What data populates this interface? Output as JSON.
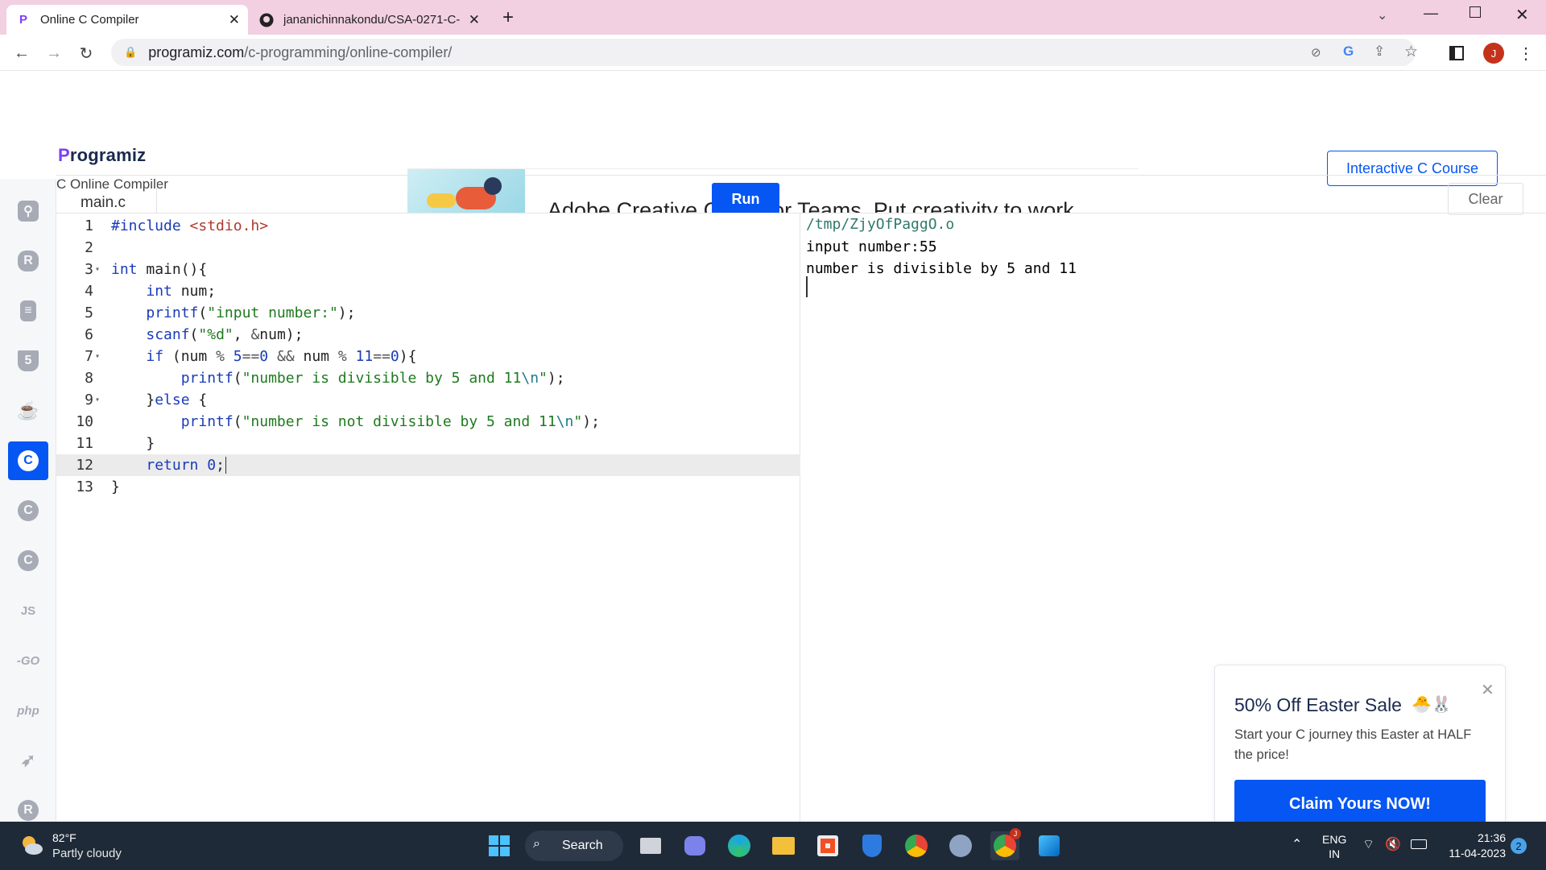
{
  "browser": {
    "tabs": [
      {
        "title": "Online C Compiler",
        "active": true
      },
      {
        "title": "jananichinnakondu/CSA-0271-C-",
        "active": false
      }
    ],
    "new_tab": "+",
    "url_host": "programiz.com",
    "url_path": "/c-programming/online-compiler/",
    "profile_initial": "J"
  },
  "header": {
    "logo_p": "P",
    "logo_rest": "rogramiz",
    "course_button": "Interactive C Course",
    "compiler_title": "C Online Compiler"
  },
  "ad": {
    "text": "Adobe Creative Cloud for Teams. Put creativity to work."
  },
  "toolbar": {
    "file_name": "main.c",
    "run_label": "Run",
    "clear_label": "Clear"
  },
  "sidebar": {
    "languages": [
      {
        "name": "python-icon",
        "glyph": "Py"
      },
      {
        "name": "r-icon",
        "glyph": "R"
      },
      {
        "name": "sql-icon",
        "glyph": "≡"
      },
      {
        "name": "html-icon",
        "glyph": "5"
      },
      {
        "name": "java-icon",
        "glyph": "☕"
      },
      {
        "name": "c-icon",
        "glyph": "C",
        "active": true
      },
      {
        "name": "cpp-icon",
        "glyph": "C"
      },
      {
        "name": "csharp-icon",
        "glyph": "C"
      },
      {
        "name": "js-icon",
        "glyph": "JS"
      },
      {
        "name": "go-icon",
        "glyph": "-GO"
      },
      {
        "name": "php-icon",
        "glyph": "php"
      },
      {
        "name": "swift-icon",
        "glyph": "➶"
      },
      {
        "name": "rust-icon",
        "glyph": "R"
      }
    ]
  },
  "editor": {
    "line_numbers": [
      "1",
      "2",
      "3",
      "4",
      "5",
      "6",
      "7",
      "8",
      "9",
      "10",
      "11",
      "12",
      "13"
    ]
  },
  "output": {
    "path": "/tmp/ZjyOfPaggO.o",
    "line1": "input number:55",
    "line2": "number is divisible by 5 and 11"
  },
  "promo": {
    "title": "50% Off Easter Sale",
    "body": "Start your C journey this Easter at HALF the price!",
    "cta": "Claim Yours NOW!"
  },
  "taskbar": {
    "weather_temp": "82°F",
    "weather_desc": "Partly cloudy",
    "search_label": "Search",
    "lang_top": "ENG",
    "lang_bottom": "IN",
    "time": "21:36",
    "date": "11-04-2023",
    "notification_count": "2",
    "chrome_badge": "J"
  }
}
